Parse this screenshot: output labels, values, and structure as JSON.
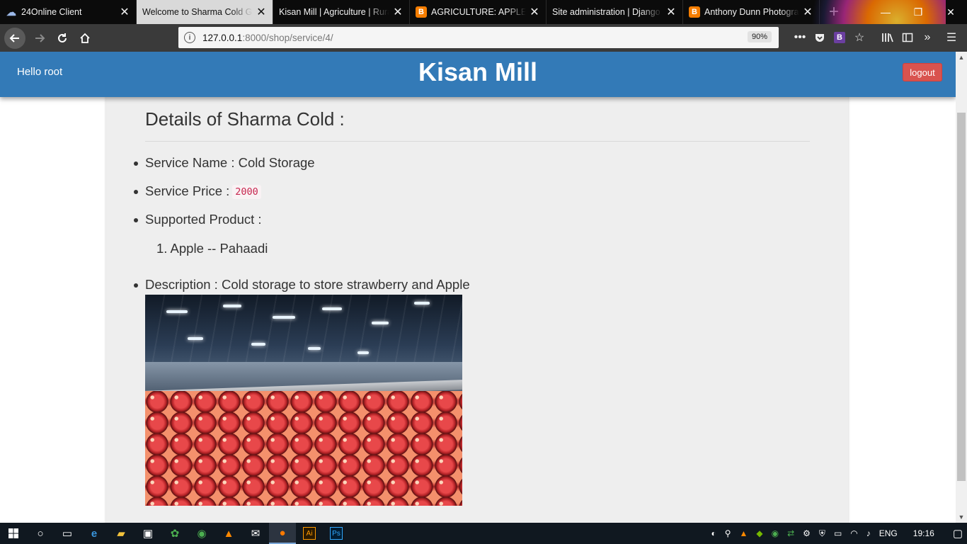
{
  "browser": {
    "tabs": [
      {
        "title": "24Online Client",
        "favicon": "cloud-icon",
        "active": false
      },
      {
        "title": "Welcome to Sharma Cold Gr",
        "favicon": "none",
        "active": true
      },
      {
        "title": "Kisan Mill | Agriculture | Rura",
        "favicon": "none",
        "active": false
      },
      {
        "title": "AGRICULTURE: APPLE DI",
        "favicon": "blogger-icon",
        "active": false
      },
      {
        "title": "Site administration | Django s",
        "favicon": "none",
        "active": false
      },
      {
        "title": "Anthony Dunn Photogra",
        "favicon": "blogger-icon",
        "active": false
      }
    ],
    "url_host": "127.0.0.1",
    "url_path": ":8000/shop/service/4/",
    "zoom": "90%",
    "extension_badge": "B"
  },
  "header": {
    "greeting": "Hello root",
    "brand": "Kisan Mill",
    "logout_label": "logout",
    "bg_color": "#337ab7",
    "logout_color": "#d9534f"
  },
  "details": {
    "title": "Details of Sharma Cold :",
    "service_name_label": "Service Name : Cold Storage",
    "service_price_label": "Service Price :",
    "service_price_value": "2000",
    "supported_label": "Supported Product :",
    "products": [
      "1. Apple -- Pahaadi"
    ],
    "description_label": "Description : Cold storage to store strawberry and Apple",
    "image_subject": "apples-in-cold-storage-photo"
  },
  "taskbar": {
    "language": "ENG",
    "time": "19:16"
  }
}
